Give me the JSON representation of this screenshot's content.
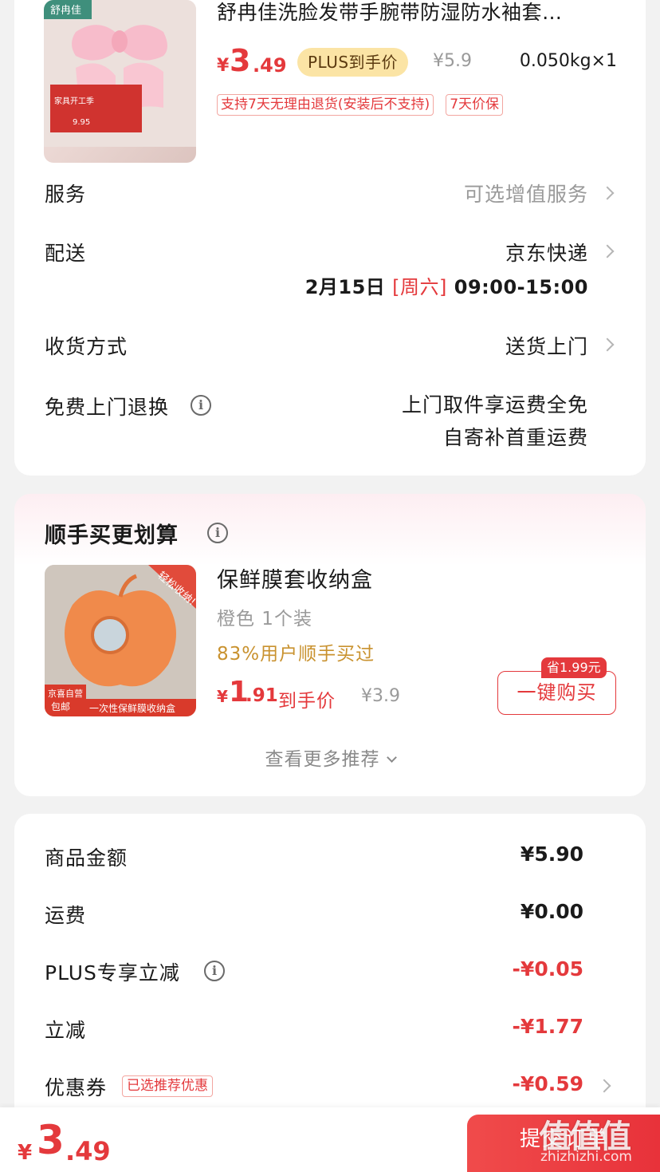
{
  "order_item": {
    "title": "舒冉佳洗脸发带手腕带防湿防水袖套…",
    "price_symbol": "¥",
    "price_int": "3",
    "price_dec": ".49",
    "plus_tag": "PLUS到手价",
    "orig_price": "¥5.9",
    "weight_qty": "0.050kg×1",
    "tags": [
      "支持7天无理由退货(安装后不支持)",
      "7天价保"
    ],
    "thumb_brand": "舒冉佳",
    "thumb_badge_text": "家具开工季",
    "thumb_price": "9.95"
  },
  "service": {
    "label": "服务",
    "value": "可选增值服务"
  },
  "delivery": {
    "label": "配送",
    "value": "京东快递",
    "date": "2月15日",
    "weekday": "[周六]",
    "time": "09:00-15:00"
  },
  "receive": {
    "label": "收货方式",
    "value": "送货上门"
  },
  "free_return": {
    "label": "免费上门退换",
    "line1": "上门取件享运费全免",
    "line2": "自寄补首重运费"
  },
  "recommend": {
    "title": "顺手买更划算",
    "product": {
      "name": "保鲜膜套收纳盒",
      "spec": "橙色 1个装",
      "bought": "83%用户顺手买过",
      "price_symbol": "¥",
      "price_int": "1",
      "price_dec": ".91",
      "price_label": "到手价",
      "orig_price": "¥3.9",
      "save_tag": "省1.99元",
      "buy_button": "一键购买",
      "thumb_corner": "轻松收纳!",
      "thumb_badge": "京喜自营",
      "thumb_badge2": "包邮",
      "thumb_caption": "一次性保鲜膜收纳盒"
    },
    "more": "查看更多推荐"
  },
  "amounts": [
    {
      "label": "商品金额",
      "value": "¥5.90",
      "red": false
    },
    {
      "label": "运费",
      "value": "¥0.00",
      "red": false
    },
    {
      "label": "PLUS专享立减",
      "value": "-¥0.05",
      "red": true
    },
    {
      "label": "立减",
      "value": "-¥1.77",
      "red": true
    },
    {
      "label": "优惠券",
      "value": "-¥0.59",
      "red": true
    }
  ],
  "coupon_tag": "已选推荐优惠",
  "bottom": {
    "total_symbol": "¥",
    "total_int": "3",
    "total_dec": ".49",
    "submit": "提交订单"
  },
  "watermark": {
    "text": "值值值",
    "url": "zhizhizhi.com"
  },
  "colors": {
    "accent": "#e4393c",
    "plus_gold": "#fbe4a5",
    "bought_gold": "#c9922f"
  },
  "icons": [
    "info-icon",
    "chevron-right-icon",
    "chevron-down-icon"
  ]
}
